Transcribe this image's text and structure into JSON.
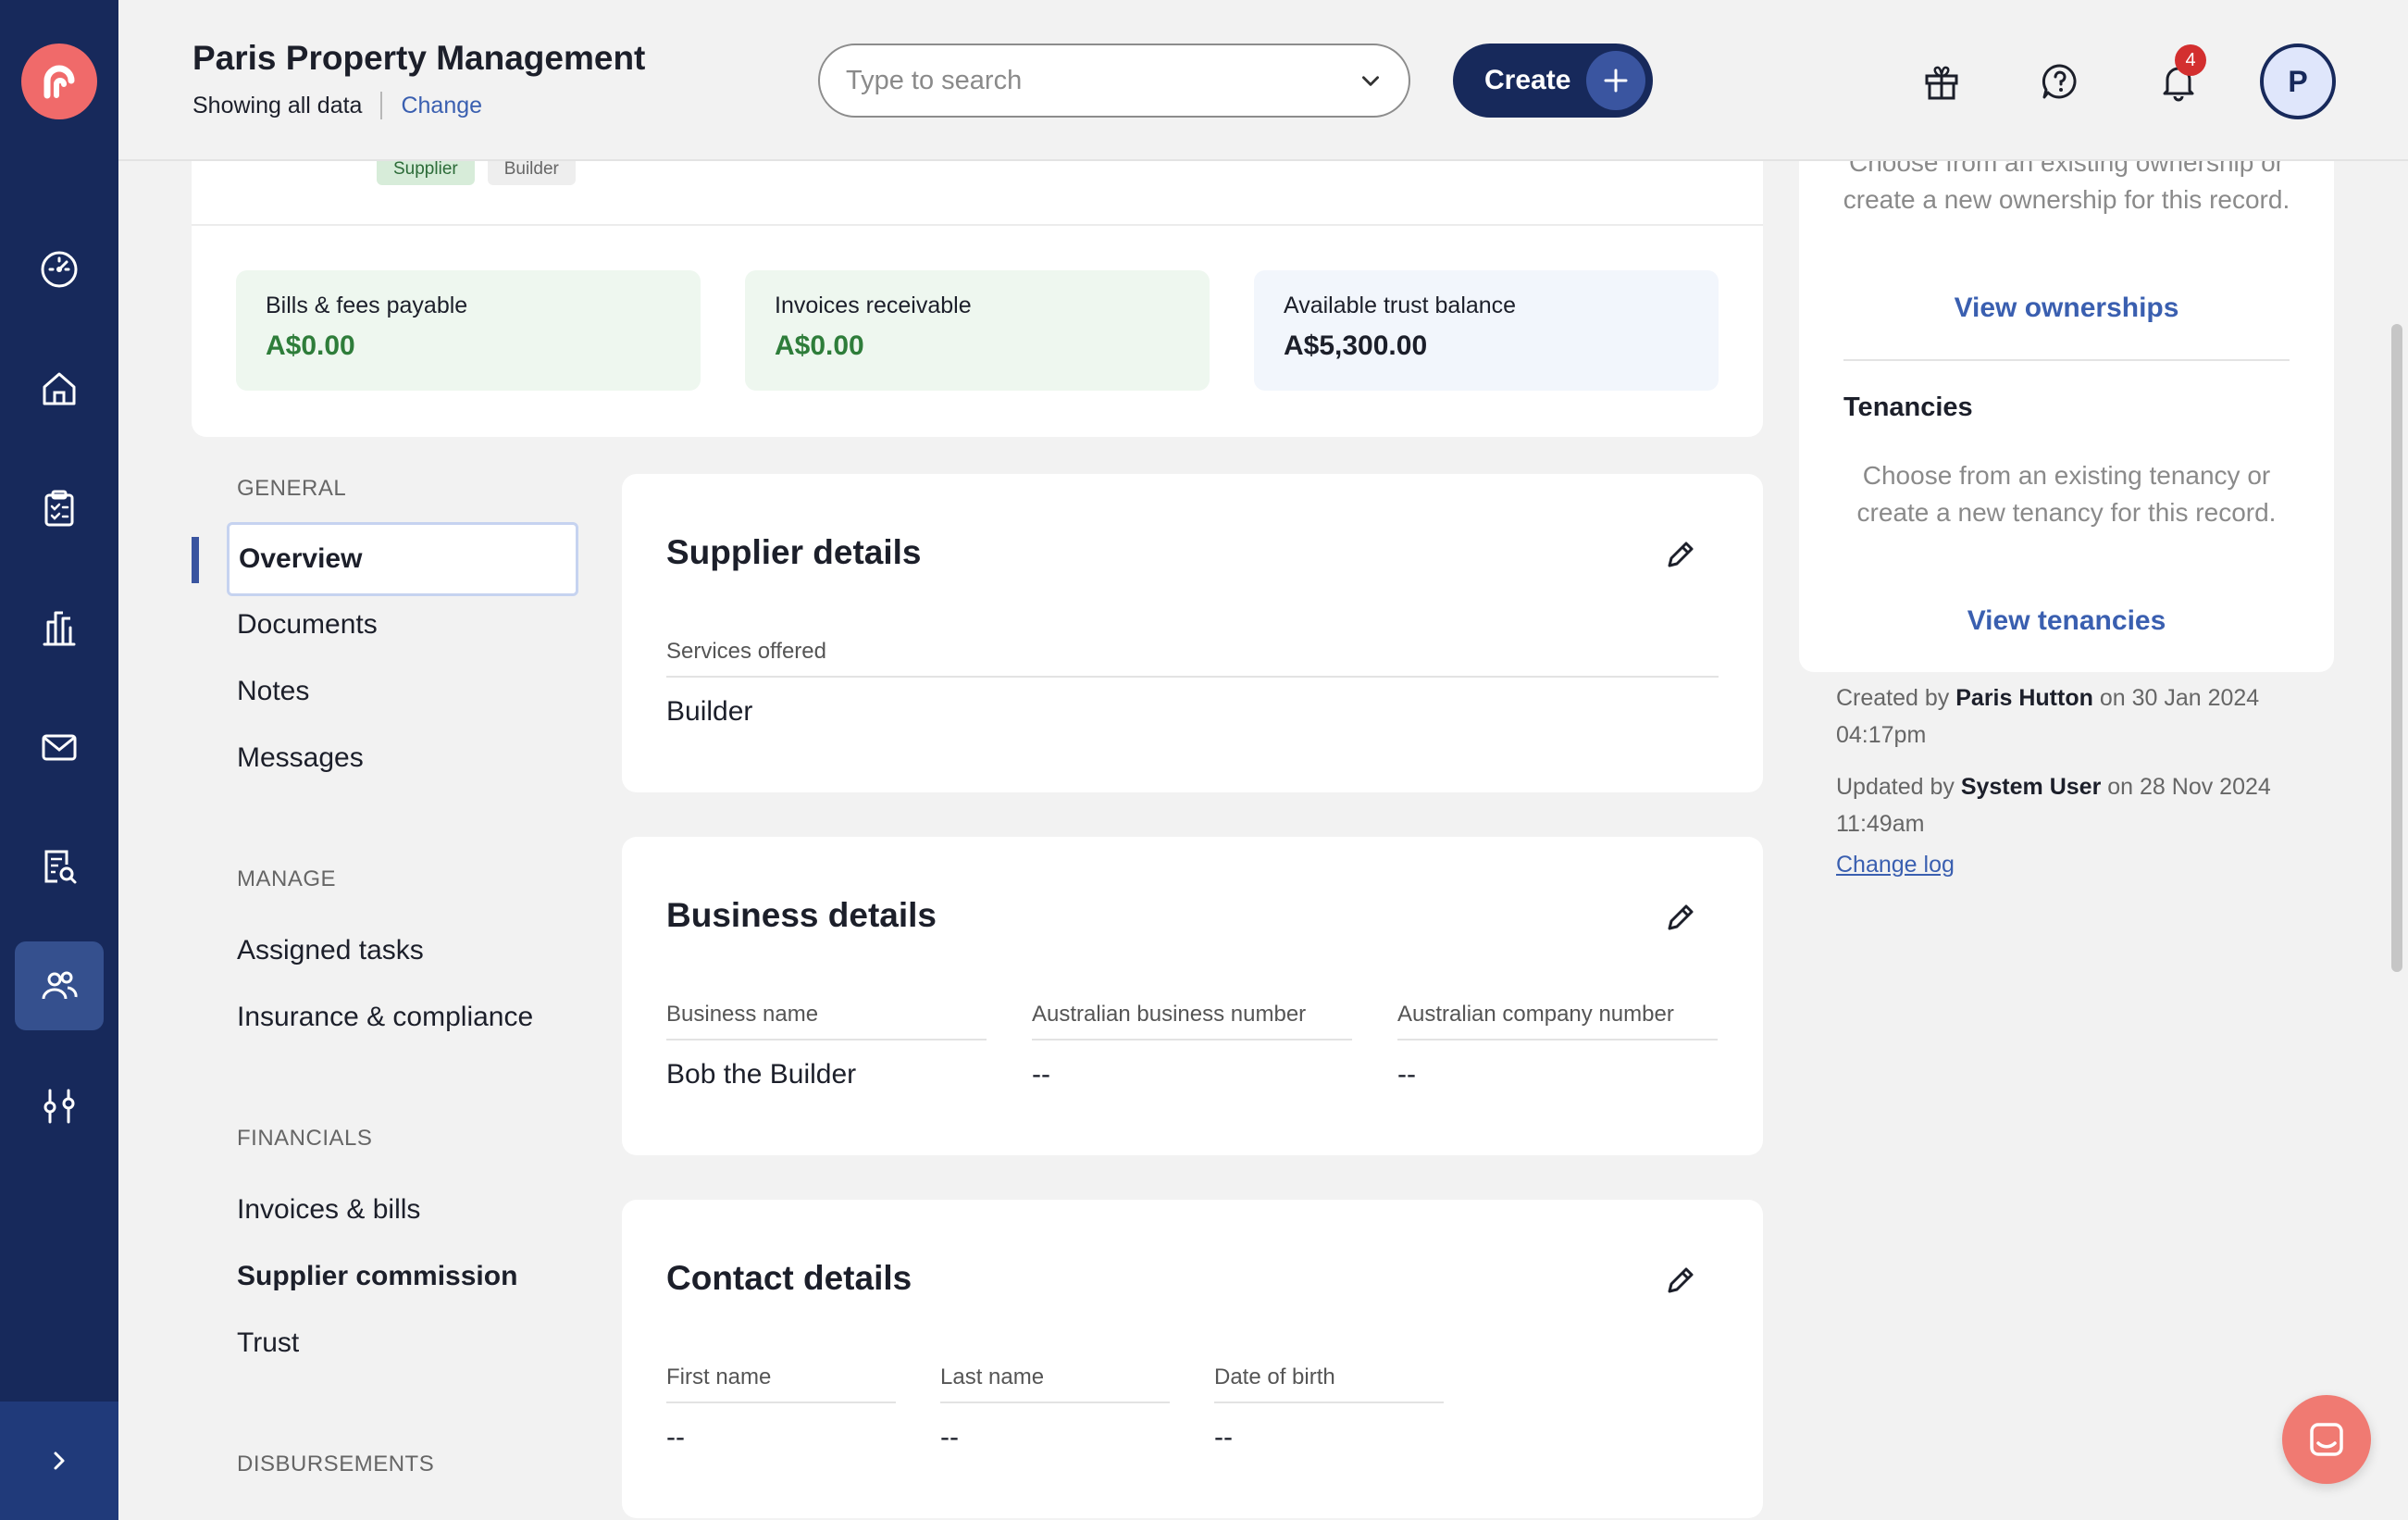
{
  "header": {
    "org_title": "Paris Property Management",
    "showing": "Showing all data",
    "change": "Change",
    "search_placeholder": "Type to search",
    "create_label": "Create",
    "notification_count": "4",
    "avatar_initial": "P"
  },
  "rail": {
    "icons": [
      "dashboard-icon",
      "home-icon",
      "clipboard-icon",
      "building-icon",
      "mail-icon",
      "report-search-icon",
      "contacts-icon",
      "sliders-icon"
    ],
    "active": "contacts-icon"
  },
  "summary": {
    "tags": [
      "Supplier",
      "Builder"
    ],
    "stats": [
      {
        "label": "Bills & fees payable",
        "value": "A$0.00"
      },
      {
        "label": "Invoices receivable",
        "value": "A$0.00"
      },
      {
        "label": "Available trust balance",
        "value": "A$5,300.00"
      }
    ]
  },
  "section_nav": {
    "general": {
      "title": "GENERAL",
      "items": [
        "Overview",
        "Documents",
        "Notes",
        "Messages"
      ]
    },
    "manage": {
      "title": "MANAGE",
      "items": [
        "Assigned tasks",
        "Insurance & compliance"
      ]
    },
    "financials": {
      "title": "FINANCIALS",
      "items": [
        "Invoices & bills",
        "Supplier commission",
        "Trust"
      ]
    },
    "disbursements": {
      "title": "DISBURSEMENTS"
    }
  },
  "supplier_details": {
    "title": "Supplier details",
    "services_label": "Services offered",
    "services_value": "Builder"
  },
  "business_details": {
    "title": "Business details",
    "fields": [
      {
        "label": "Business name",
        "value": "Bob the Builder"
      },
      {
        "label": "Australian business number",
        "value": "--"
      },
      {
        "label": "Australian company number",
        "value": "--"
      }
    ]
  },
  "contact_details": {
    "title": "Contact details",
    "fields": [
      {
        "label": "First name",
        "value": "--"
      },
      {
        "label": "Last name",
        "value": "--"
      },
      {
        "label": "Date of birth",
        "value": "--"
      }
    ]
  },
  "right_panel": {
    "ownership_text_line1": "Choose from an existing ownership",
    "ownership_text_rest": "or create a new ownership for this record.",
    "view_ownerships": "View ownerships",
    "tenancies_heading": "Tenancies",
    "tenancies_text": "Choose from an existing tenancy or create a new tenancy for this record.",
    "view_tenancies": "View tenancies"
  },
  "meta": {
    "created_prefix": "Created by",
    "created_by": "Paris Hutton",
    "created_on": "on 30 Jan 2024 04:17pm",
    "updated_prefix": "Updated by",
    "updated_by": "System User",
    "updated_on": "on 28 Nov 2024 11:49am",
    "change_log": "Change log"
  },
  "colors": {
    "rail": "#17295b",
    "accent": "#3a5fb0",
    "brand": "#f06a6a",
    "positive": "#2e7d3a",
    "badge": "#d32f2f"
  }
}
